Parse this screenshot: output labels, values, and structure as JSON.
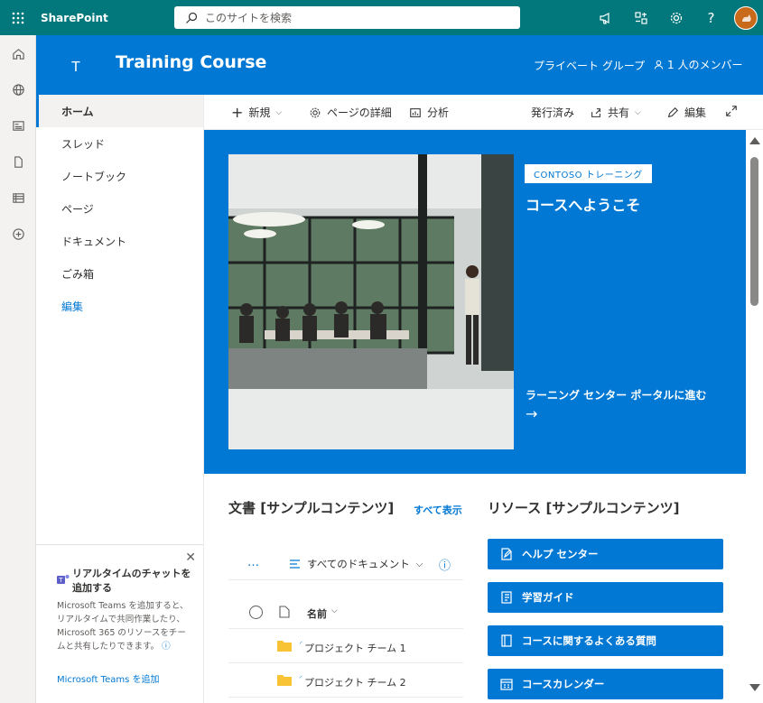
{
  "suite": {
    "brand": "SharePoint",
    "search_placeholder": "このサイトを検索"
  },
  "site": {
    "logo_letter": "T",
    "title": "Training Course",
    "privacy": "プライベート グループ",
    "members": "1 人のメンバー"
  },
  "nav": {
    "items": [
      "ホーム",
      "スレッド",
      "ノートブック",
      "ページ",
      "ドキュメント",
      "ごみ箱"
    ],
    "edit": "編集"
  },
  "teams_card": {
    "title": "リアルタイムのチャットを追加する",
    "body": "Microsoft Teams を追加すると、リアルタイムで共同作業したり、Microsoft 365 のリソースをチームと共有したりできます。",
    "link": "Microsoft Teams を追加"
  },
  "command_bar": {
    "new": "新規",
    "page_details": "ページの詳細",
    "analytics": "分析",
    "status": "発行済み",
    "share": "共有",
    "edit": "編集"
  },
  "hero": {
    "tag": "CONTOSO トレーニング",
    "title": "コースへようこそ",
    "link": "ラーニング センター ポータルに進む",
    "arrow": "→"
  },
  "documents": {
    "title": "文書 [サンプルコンテンツ]",
    "see_all": "すべて表示",
    "more": "…",
    "view": "すべてのドキュメント",
    "column_name": "名前",
    "rows": [
      "プロジェクト チーム 1",
      "プロジェクト チーム 2"
    ]
  },
  "resources": {
    "title": "リソース [サンプルコンテンツ]",
    "items": [
      {
        "label": "ヘルプ センター",
        "icon": "edit-doc-icon"
      },
      {
        "label": "学習ガイド",
        "icon": "notebook-icon"
      },
      {
        "label": "コースに関するよくある質問",
        "icon": "book-icon"
      },
      {
        "label": "コースカレンダー",
        "icon": "calendar-icon"
      }
    ]
  },
  "colors": {
    "suite": "#03787c",
    "brand_blue": "#0078d4"
  }
}
